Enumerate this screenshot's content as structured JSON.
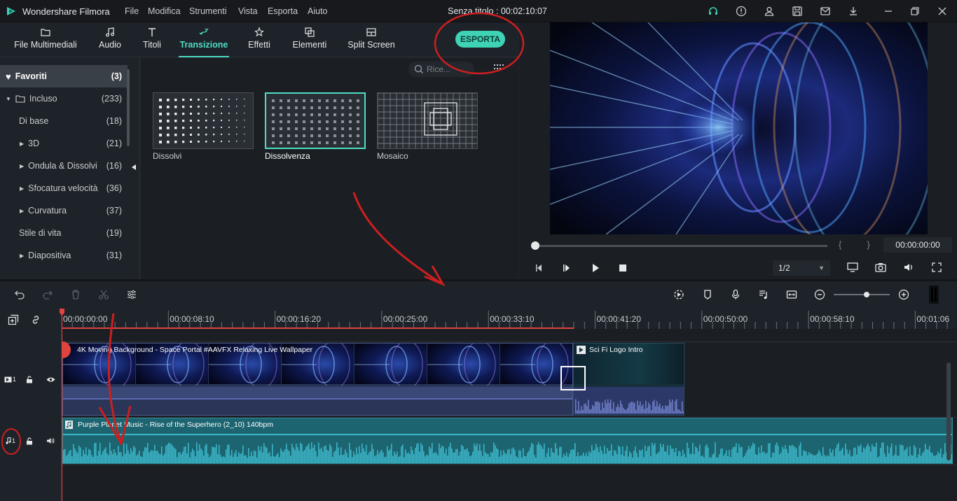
{
  "app": {
    "name": "Wondershare Filmora",
    "doc_title": "Senza titolo : 00:02:10:07"
  },
  "menu": [
    "File",
    "Modifica",
    "Strumenti",
    "Vista",
    "Esporta",
    "Aiuto"
  ],
  "titlebar_icons": [
    "headset-icon",
    "info-icon",
    "account-icon",
    "save-icon",
    "mail-icon",
    "download-icon",
    "minimize-icon",
    "maximize-icon",
    "close-icon"
  ],
  "tabs": [
    {
      "label": "File Multimediali",
      "icon": "folder-icon"
    },
    {
      "label": "Audio",
      "icon": "music-icon"
    },
    {
      "label": "Titoli",
      "icon": "text-icon"
    },
    {
      "label": "Transizione",
      "icon": "transition-icon",
      "active": true
    },
    {
      "label": "Effetti",
      "icon": "effects-icon"
    },
    {
      "label": "Elementi",
      "icon": "elements-icon"
    },
    {
      "label": "Split Screen",
      "icon": "split-screen-icon"
    }
  ],
  "export_label": "ESPORTA",
  "search_placeholder": "Rice...",
  "sidebar": [
    {
      "label": "Favoriti",
      "count": "(3)",
      "type": "fav"
    },
    {
      "label": "Incluso",
      "count": "(233)",
      "type": "folder"
    },
    {
      "label": "Di base",
      "count": "(18)",
      "type": "plain"
    },
    {
      "label": "3D",
      "count": "(21)",
      "type": "arrow"
    },
    {
      "label": "Ondula & Dissolvi",
      "count": "(16)",
      "type": "arrow"
    },
    {
      "label": "Sfocatura velocità",
      "count": "(36)",
      "type": "arrow"
    },
    {
      "label": "Curvatura",
      "count": "(37)",
      "type": "arrow"
    },
    {
      "label": "Stile di vita",
      "count": "(19)",
      "type": "plain"
    },
    {
      "label": "Diapositiva",
      "count": "(31)",
      "type": "arrow"
    }
  ],
  "transitions": [
    {
      "label": "Dissolvi"
    },
    {
      "label": "Dissolvenza",
      "selected": true
    },
    {
      "label": "Mosaico"
    }
  ],
  "preview": {
    "timecode": "00:00:00:00",
    "quality": "1/2",
    "brackets": "{          }"
  },
  "ruler": [
    "00:00:00:00",
    "00:00:08:10",
    "00:00:16:20",
    "00:00:25:00",
    "00:00:33:10",
    "00:00:41:20",
    "00:00:50:00",
    "00:00:58:10",
    "00:01:06"
  ],
  "clips": {
    "video1": "4K Moving Background - Space Portal #AAVFX Relaxing Live Wallpaper",
    "video2": "Sci Fi Logo Intro",
    "audio": "Purple Planet Music - Rise of the Superhero (2_10) 140bpm"
  },
  "tracks": {
    "video_num": "1",
    "audio_num": "1"
  },
  "colors": {
    "accent": "#4fdcc4",
    "export": "#3fd3b5",
    "playhead": "#ff5a5a",
    "audio_clip": "#1f6f7a",
    "annotation": "#cc1f1f"
  }
}
